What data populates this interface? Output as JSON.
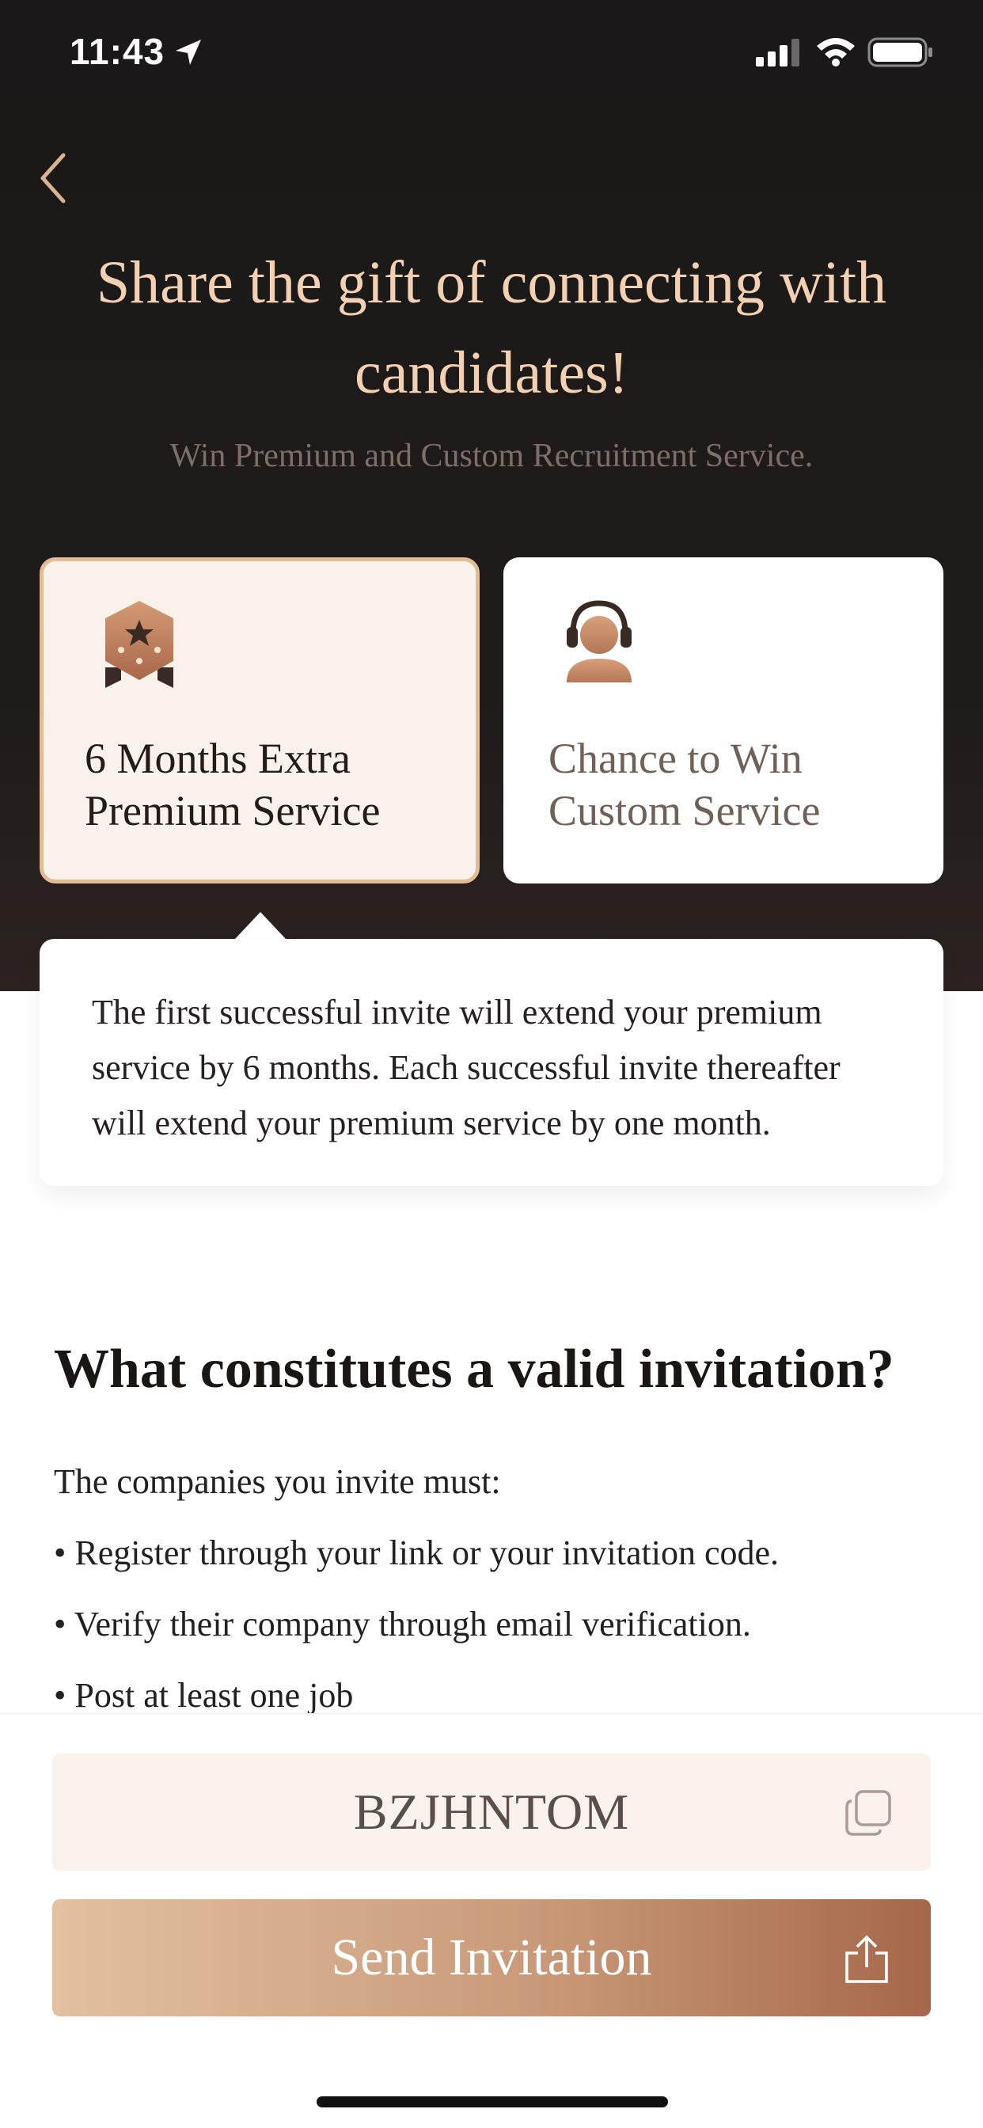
{
  "status_bar": {
    "time": "11:43",
    "icons": [
      "location-arrow-icon",
      "cellular-signal-icon",
      "wifi-icon",
      "battery-icon"
    ]
  },
  "navigation": {
    "back_icon": "chevron-left-icon"
  },
  "hero": {
    "headline": "Share the gift of connecting with candidates!",
    "subheadline": "Win Premium and Custom Recruitment Service."
  },
  "rewards": [
    {
      "label": "6 Months Extra Premium Service",
      "icon": "premium-badge-icon",
      "selected": true
    },
    {
      "label": "Chance to Win Custom Service",
      "icon": "customer-service-headset-icon",
      "selected": false
    }
  ],
  "reward_detail": {
    "text": "The first successful invite will extend your premium service by 6 months. Each successful invite thereafter will extend your premium service by one month."
  },
  "validity": {
    "title": "What constitutes a valid invitation?",
    "intro": "The companies you invite must:",
    "rules": [
      "• Register through your link or your invitation code.",
      "• Verify their company through email verification.",
      "• Post at least one job"
    ]
  },
  "invite": {
    "code": "BZJHNTOM",
    "copy_icon": "copy-icon",
    "send_label": "Send Invitation",
    "share_icon": "share-icon"
  },
  "colors": {
    "hero_background": "#1a1818",
    "headline": "#f2d0b1",
    "accent_border": "#e3bc96",
    "selected_card": "#f9f2ea",
    "button_gradient_start": "#e2c0a0",
    "button_gradient_end": "#a6674a"
  }
}
